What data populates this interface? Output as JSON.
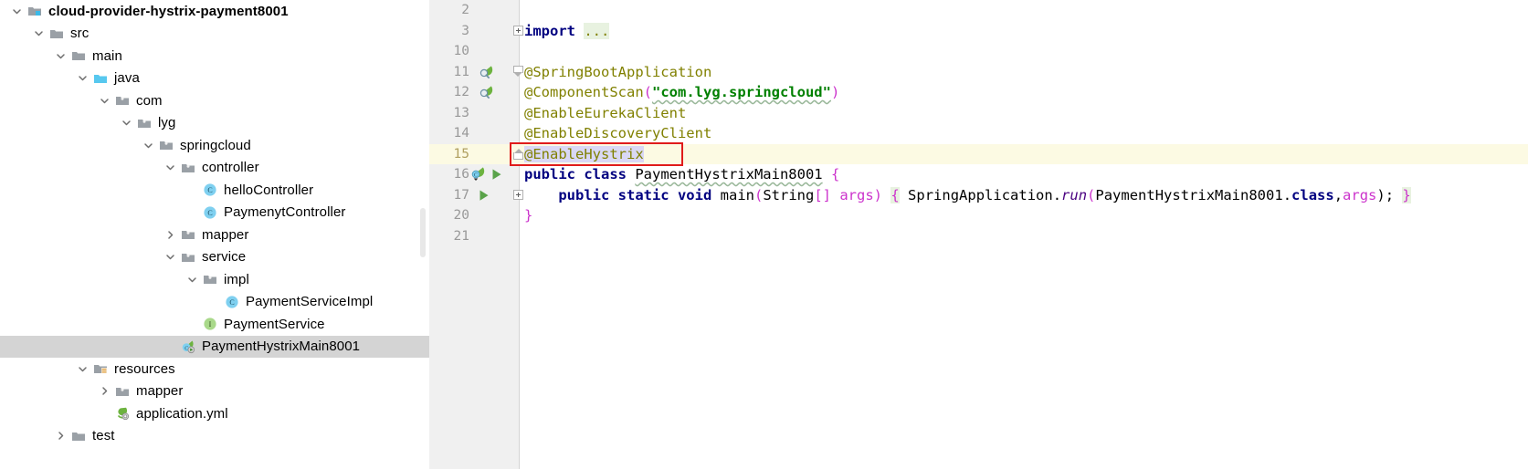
{
  "project_tree": {
    "name": "project-tree",
    "items": [
      {
        "label": "cloud-provider-hystrix-payment8001",
        "depth": 0,
        "twisty": "down",
        "icon": "module-icon",
        "bold": true,
        "selected": false
      },
      {
        "label": "src",
        "depth": 1,
        "twisty": "down",
        "icon": "folder-icon",
        "bold": false,
        "selected": false
      },
      {
        "label": "main",
        "depth": 2,
        "twisty": "down",
        "icon": "folder-icon",
        "bold": false,
        "selected": false
      },
      {
        "label": "java",
        "depth": 3,
        "twisty": "down",
        "icon": "source-root-icon",
        "bold": false,
        "selected": false
      },
      {
        "label": "com",
        "depth": 4,
        "twisty": "down",
        "icon": "package-icon",
        "bold": false,
        "selected": false
      },
      {
        "label": "lyg",
        "depth": 5,
        "twisty": "down",
        "icon": "package-icon",
        "bold": false,
        "selected": false
      },
      {
        "label": "springcloud",
        "depth": 6,
        "twisty": "down",
        "icon": "package-icon",
        "bold": false,
        "selected": false
      },
      {
        "label": "controller",
        "depth": 7,
        "twisty": "down",
        "icon": "package-icon",
        "bold": false,
        "selected": false
      },
      {
        "label": "helloController",
        "depth": 8,
        "twisty": "none",
        "icon": "java-class-icon",
        "bold": false,
        "selected": false
      },
      {
        "label": "PaymenytController",
        "depth": 8,
        "twisty": "none",
        "icon": "java-class-icon",
        "bold": false,
        "selected": false
      },
      {
        "label": "mapper",
        "depth": 7,
        "twisty": "right",
        "icon": "package-icon",
        "bold": false,
        "selected": false
      },
      {
        "label": "service",
        "depth": 7,
        "twisty": "down",
        "icon": "package-icon",
        "bold": false,
        "selected": false
      },
      {
        "label": "impl",
        "depth": 8,
        "twisty": "down",
        "icon": "package-icon",
        "bold": false,
        "selected": false
      },
      {
        "label": "PaymentServiceImpl",
        "depth": 9,
        "twisty": "none",
        "icon": "java-class-icon",
        "bold": false,
        "selected": false
      },
      {
        "label": "PaymentService",
        "depth": 8,
        "twisty": "none",
        "icon": "java-interface-icon",
        "bold": false,
        "selected": false
      },
      {
        "label": "PaymentHystrixMain8001",
        "depth": 7,
        "twisty": "none",
        "icon": "spring-boot-class-icon",
        "bold": false,
        "selected": true
      },
      {
        "label": "resources",
        "depth": 3,
        "twisty": "down",
        "icon": "resources-root-icon",
        "bold": false,
        "selected": false
      },
      {
        "label": "mapper",
        "depth": 4,
        "twisty": "right",
        "icon": "package-icon",
        "bold": false,
        "selected": false
      },
      {
        "label": "application.yml",
        "depth": 4,
        "twisty": "none",
        "icon": "spring-yaml-icon",
        "bold": false,
        "selected": false
      },
      {
        "label": "test",
        "depth": 2,
        "twisty": "right",
        "icon": "folder-icon",
        "bold": false,
        "selected": false
      }
    ]
  },
  "editor": {
    "name": "code-editor",
    "file": "PaymentHystrixMain8001",
    "highlighted_line": "15",
    "error_box_target": "@EnableHystrix",
    "lines": [
      {
        "num": "2",
        "gutter_icon": "none",
        "fold": "none",
        "highlight": false
      },
      {
        "num": "3",
        "gutter_icon": "none",
        "fold": "plus",
        "highlight": false,
        "text": "import ..."
      },
      {
        "num": "10",
        "gutter_icon": "none",
        "fold": "none",
        "highlight": false,
        "text": ""
      },
      {
        "num": "11",
        "gutter_icon": "spring-bean-icon",
        "fold": "tri",
        "highlight": false,
        "text": "@SpringBootApplication"
      },
      {
        "num": "12",
        "gutter_icon": "spring-bean-icon",
        "fold": "none",
        "highlight": false,
        "text": "@ComponentScan(\"com.lyg.springcloud\")"
      },
      {
        "num": "13",
        "gutter_icon": "none",
        "fold": "none",
        "highlight": false,
        "text": "@EnableEurekaClient"
      },
      {
        "num": "14",
        "gutter_icon": "none",
        "fold": "none",
        "highlight": false,
        "text": "@EnableDiscoveryClient"
      },
      {
        "num": "15",
        "gutter_icon": "none",
        "fold": "end",
        "highlight": true,
        "text": "@EnableHystrix"
      },
      {
        "num": "16",
        "gutter_icon": "spring-run-icon",
        "fold": "none",
        "highlight": false,
        "text": "public class PaymentHystrixMain8001 {"
      },
      {
        "num": "17",
        "gutter_icon": "run-icon",
        "fold": "plus",
        "highlight": false,
        "text": "    public static void main(String[] args) { SpringApplication.run(PaymentHystrixMain8001.class,args); }"
      },
      {
        "num": "20",
        "gutter_icon": "none",
        "fold": "none",
        "highlight": false,
        "text": "}"
      },
      {
        "num": "21",
        "gutter_icon": "none",
        "fold": "none",
        "highlight": false,
        "text": ""
      }
    ],
    "tokens": {
      "import_kw": "import",
      "import_dots": "...",
      "spring_boot_application": "@SpringBootApplication",
      "component_scan": "@ComponentScan",
      "component_scan_arg": "\"com.lyg.springcloud\"",
      "enable_eureka_client": "@EnableEurekaClient",
      "enable_discovery_client": "@EnableDiscoveryClient",
      "enable_hystrix": "@EnableHystrix",
      "public": "public",
      "class": "class",
      "class_name": "PaymentHystrixMain8001",
      "open_brace": "{",
      "static": "static",
      "void": "void",
      "main": "main",
      "string_type": "String",
      "brackets": "[]",
      "args_param": "args",
      "spring_application": "SpringApplication",
      "run_method": "run",
      "class_literal": "class",
      "args_arg": "args",
      "close_brace": "}"
    }
  },
  "colors": {
    "annotation": "#808000",
    "keyword": "#000080",
    "string": "#008000",
    "paren": "#cc33cc",
    "italic_method": "#4a0080",
    "error_box": "#e01b1b",
    "highlight_line": "#fcfae3",
    "selection": "#d9d8f5",
    "gutter_bg": "#f0f0f0",
    "tree_selection": "#d4d4d4"
  }
}
